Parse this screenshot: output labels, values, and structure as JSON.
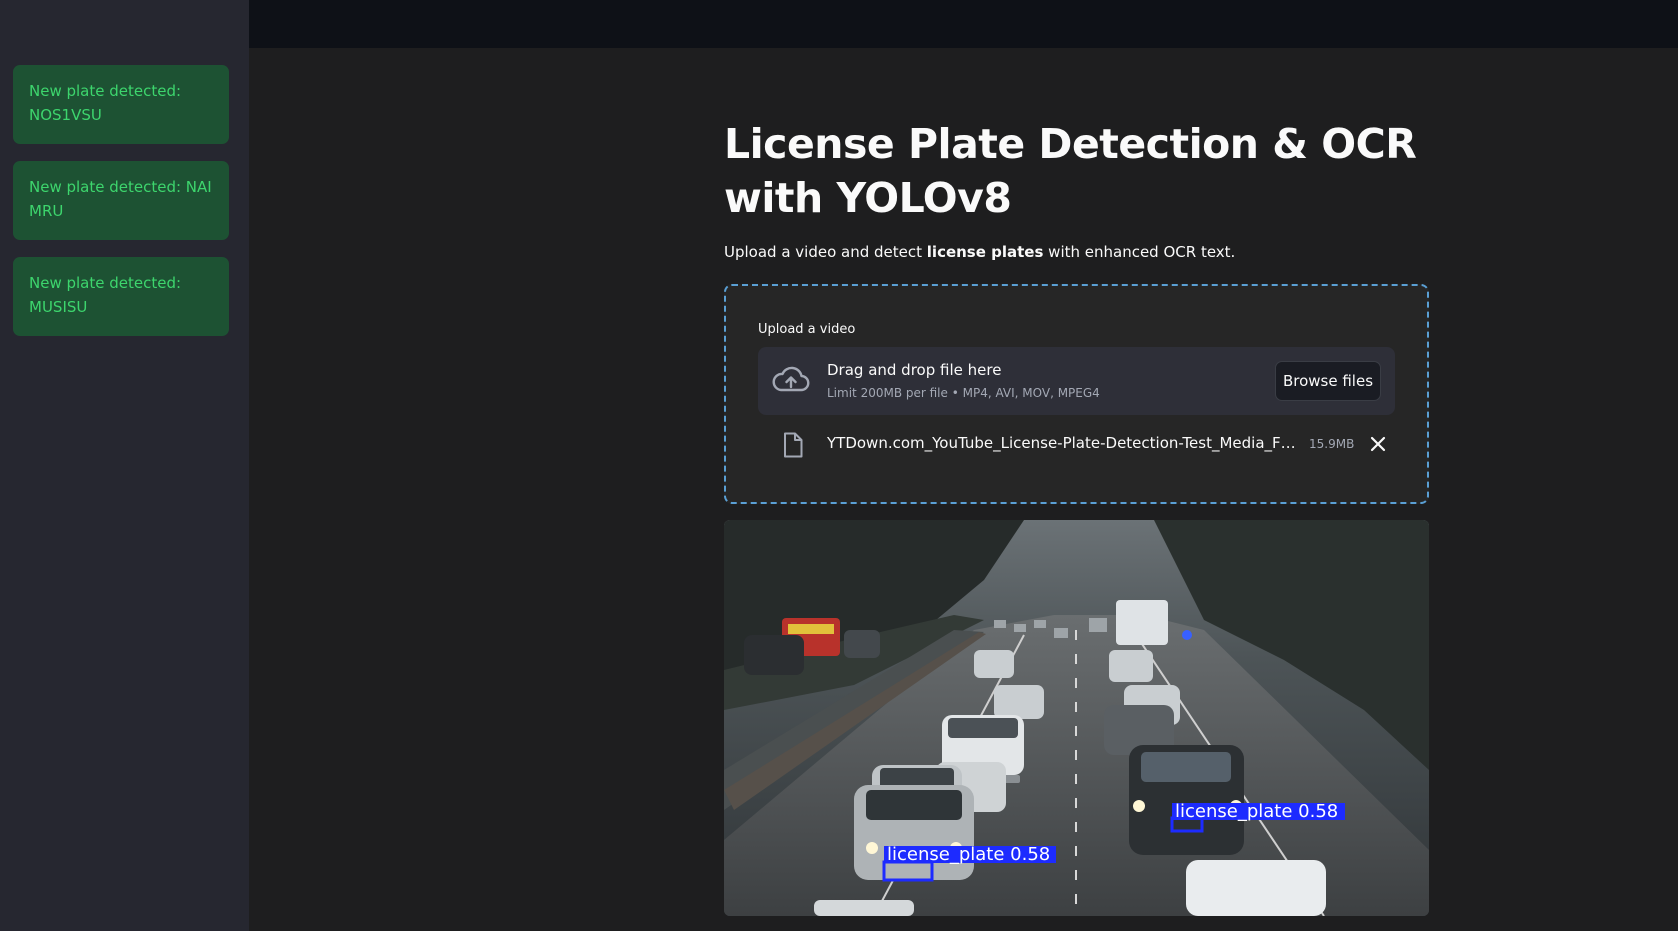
{
  "sidebar": {
    "alerts": [
      {
        "text": "New plate detected: NOS1VSU"
      },
      {
        "text": "New plate detected: NAI MRU"
      },
      {
        "text": "New plate detected: MUSISU"
      }
    ]
  },
  "main": {
    "title": "License Plate Detection & OCR with YOLOv8",
    "subtitle": {
      "before": "Upload a video and detect ",
      "bold": "license plates",
      "after": " with enhanced OCR text."
    },
    "uploader": {
      "label": "Upload a video",
      "drop_text": "Drag and drop file here",
      "limit_text": "Limit 200MB per file • MP4, AVI, MOV, MPEG4",
      "browse_label": "Browse files",
      "file": {
        "name": "YTDown.com_YouTube_License-Plate-Detection-Test_Media_FsGPxhi...",
        "size": "15.9MB"
      }
    },
    "video": {
      "detections": [
        {
          "label": "license_plate 0.58"
        },
        {
          "label": "license_plate 0.58"
        }
      ]
    }
  },
  "colors": {
    "alert_bg": "#1d5233",
    "alert_text": "#3dd56d",
    "detection_box": "#1d2bff",
    "uploader_border": "#5a9fd4"
  }
}
